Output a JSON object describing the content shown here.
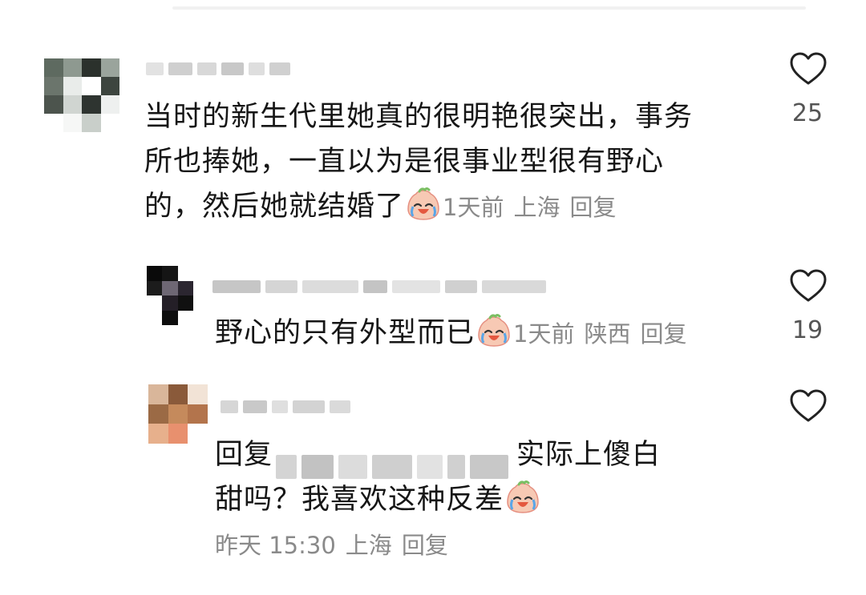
{
  "comments": [
    {
      "text_lines": [
        "当时的新生代里她真的很明艳很突出，事务",
        "所也捧她，一直以为是很事业型很有野心"
      ],
      "last_line": "的，然后她就结婚了",
      "emoji": "loudly-crying-face-icon",
      "time": "1天前",
      "location": "上海",
      "reply_label": "回复",
      "likes": "25"
    },
    {
      "text": "野心的只有外型而已",
      "emoji": "loudly-crying-face-icon",
      "time": "1天前",
      "location": "陕西",
      "reply_label": "回复",
      "likes": "19"
    },
    {
      "reply_prefix": "回复",
      "text_after_mention": "实际上傻白",
      "text_line2": "甜吗？我喜欢这种反差",
      "emoji": "loudly-crying-face-icon",
      "time": "昨天 15:30",
      "location": "上海",
      "reply_label": "回复",
      "likes": ""
    }
  ],
  "colors": {
    "text": "#161616",
    "meta": "#8a8a8a",
    "heart": "#222222"
  }
}
